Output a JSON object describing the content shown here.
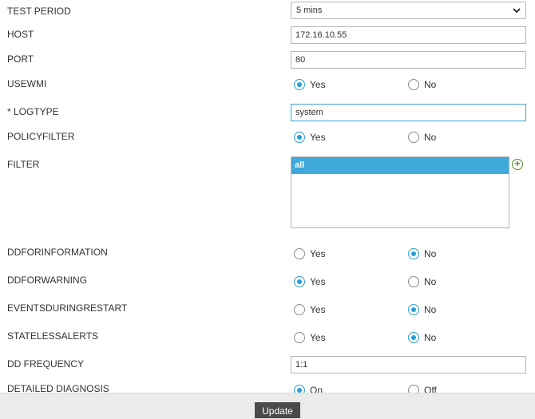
{
  "form": {
    "test_period": {
      "label": "TEST PERIOD",
      "value": "5 mins"
    },
    "host": {
      "label": "HOST",
      "value": "172.16.10.55"
    },
    "port": {
      "label": "PORT",
      "value": "80"
    },
    "usewmi": {
      "label": "USEWMI",
      "yes": "Yes",
      "no": "No",
      "selected": "yes"
    },
    "logtype": {
      "label": "* LOGTYPE",
      "value": "system"
    },
    "policyfilter": {
      "label": "POLICYFILTER",
      "yes": "Yes",
      "no": "No",
      "selected": "yes"
    },
    "filter": {
      "label": "FILTER",
      "items": [
        "all"
      ],
      "add_icon": "plus-circle-icon"
    },
    "ddforinformation": {
      "label": "DDFORINFORMATION",
      "yes": "Yes",
      "no": "No",
      "selected": "no"
    },
    "ddforwarning": {
      "label": "DDFORWARNING",
      "yes": "Yes",
      "no": "No",
      "selected": "yes"
    },
    "eventsduringrestart": {
      "label": "EVENTSDURINGRESTART",
      "yes": "Yes",
      "no": "No",
      "selected": "no"
    },
    "statelessalerts": {
      "label": "STATELESSALERTS",
      "yes": "Yes",
      "no": "No",
      "selected": "no"
    },
    "dd_frequency": {
      "label": "DD FREQUENCY",
      "value": "1:1"
    },
    "detailed_diagnosis": {
      "label": "DETAILED DIAGNOSIS",
      "on": "On",
      "off": "Off",
      "selected": "on"
    }
  },
  "footer": {
    "update_label": "Update"
  },
  "colors": {
    "accent": "#2a9fd6",
    "selection": "#3fa9d9",
    "button": "#4a4a4a"
  }
}
